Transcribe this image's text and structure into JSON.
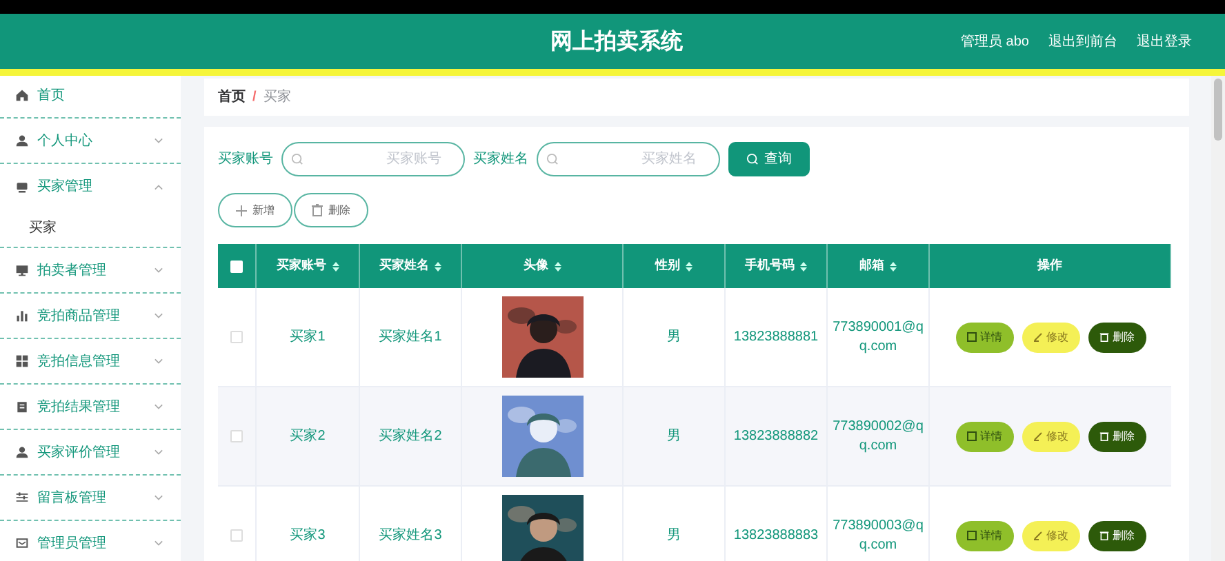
{
  "header": {
    "title": "网上拍卖系统",
    "user": "管理员 abo",
    "links": [
      "退出到前台",
      "退出登录"
    ]
  },
  "sidebar": {
    "items": [
      {
        "label": "首页"
      },
      {
        "label": "个人中心",
        "expanded": false
      },
      {
        "label": "买家管理",
        "expanded": true,
        "children": [
          {
            "label": "买家"
          }
        ]
      },
      {
        "label": "拍卖者管理",
        "expanded": false
      },
      {
        "label": "竞拍商品管理",
        "expanded": false
      },
      {
        "label": "竞拍信息管理",
        "expanded": false
      },
      {
        "label": "竞拍结果管理",
        "expanded": false
      },
      {
        "label": "买家评价管理",
        "expanded": false
      },
      {
        "label": "留言板管理",
        "expanded": false
      },
      {
        "label": "管理员管理",
        "expanded": false
      }
    ]
  },
  "breadcrumb": [
    "首页",
    "/",
    "买家"
  ],
  "search": {
    "fields": [
      {
        "label": "买家账号",
        "placeholder": "买家账号"
      },
      {
        "label": "买家姓名",
        "placeholder": "买家姓名"
      }
    ],
    "button": "查询"
  },
  "actions": [
    "新增",
    "删除"
  ],
  "table": {
    "select_all": {
      "checked": false
    },
    "columns": [
      "买家账号",
      "买家姓名",
      "头像",
      "性别",
      "手机号码",
      "邮箱",
      "操作"
    ],
    "rows": [
      {
        "checked": false,
        "cells": [
          "买家1",
          "买家姓名1",
          {
            "kind": "picture"
          },
          "男",
          "13823888881",
          "773890001@qq.com"
        ],
        "buttons": [
          "详情",
          "修改",
          "删除"
        ]
      },
      {
        "checked": false,
        "cells": [
          "买家2",
          "买家姓名2",
          {
            "kind": "picture"
          },
          "男",
          "13823888882",
          "773890002@qq.com"
        ],
        "buttons": [
          "详情",
          "修改",
          "删除"
        ]
      },
      {
        "checked": false,
        "cells": [
          "买家3",
          "买家姓名3",
          {
            "kind": "picture"
          },
          "男",
          "13823888883",
          "773890003@qq.com"
        ],
        "buttons": [
          "详情",
          "修改",
          "删除"
        ]
      }
    ]
  }
}
